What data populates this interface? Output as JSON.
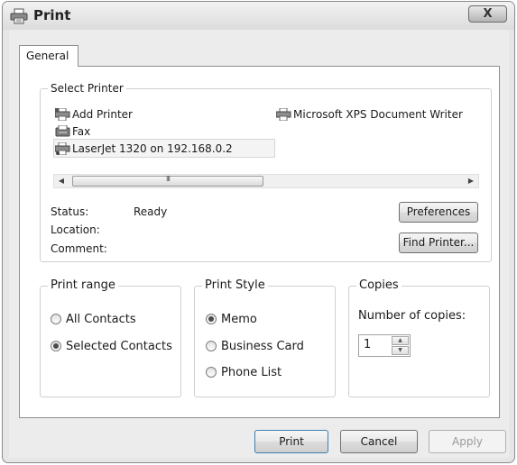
{
  "window": {
    "title": "Print",
    "close_label": "X"
  },
  "tabs": [
    {
      "label": "General"
    }
  ],
  "select_printer": {
    "legend": "Select Printer",
    "printers": [
      {
        "label": "Add Printer",
        "icon": "add-printer-icon"
      },
      {
        "label": "Microsoft XPS Document Writer",
        "icon": "printer-icon"
      },
      {
        "label": "Fax",
        "icon": "fax-icon"
      },
      {
        "label": "LaserJet 1320 on 192.168.0.2",
        "icon": "printer-icon",
        "selected": true
      }
    ],
    "scroll_grip": "III",
    "status_label": "Status:",
    "status_value": "Ready",
    "location_label": "Location:",
    "comment_label": "Comment:",
    "preferences_label": "Preferences",
    "find_printer_label": "Find Printer..."
  },
  "print_range": {
    "legend": "Print range",
    "options": [
      {
        "label": "All Contacts",
        "checked": false
      },
      {
        "label": "Selected Contacts",
        "checked": true
      }
    ]
  },
  "print_style": {
    "legend": "Print Style",
    "options": [
      {
        "label": "Memo",
        "checked": true
      },
      {
        "label": "Business Card",
        "checked": false
      },
      {
        "label": "Phone List",
        "checked": false
      }
    ]
  },
  "copies": {
    "legend": "Copies",
    "label": "Number of copies:",
    "value": "1"
  },
  "footer": {
    "print_label": "Print",
    "cancel_label": "Cancel",
    "apply_label": "Apply"
  }
}
